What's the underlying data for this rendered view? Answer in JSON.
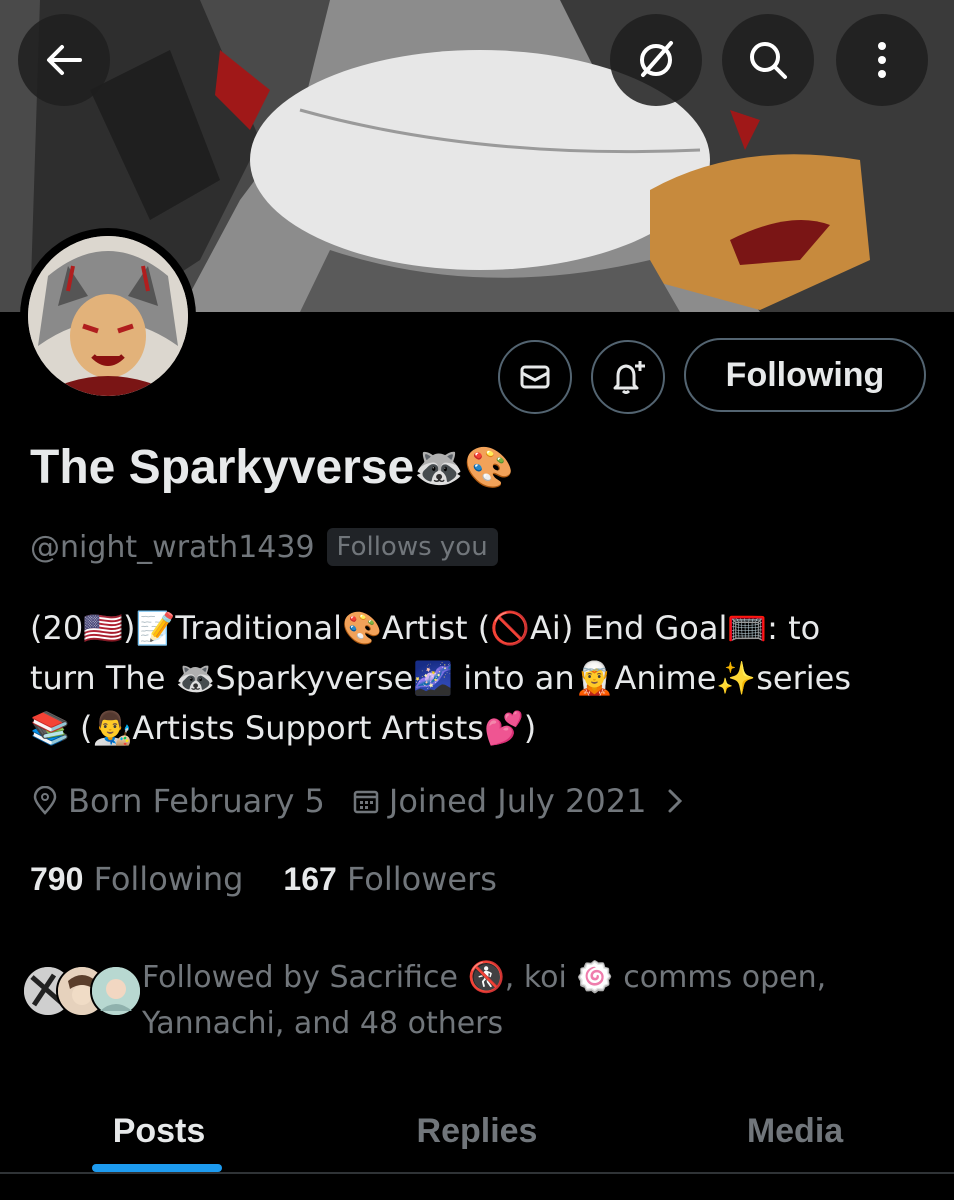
{
  "profile": {
    "display_name": "The Sparkyverse",
    "name_emojis": "🦝🎨",
    "handle": "@night_wrath1439",
    "follows_you_badge": "Follows you",
    "bio_lines": [
      "(20🇺🇸)📝Traditional🎨Artist (🚫Ai) End Goal🥅: to",
      "turn The 🦝Sparkyverse🌌 into an🧝Anime✨series",
      "📚 (👨‍🎨Artists Support Artists💕)"
    ],
    "born": "Born February 5",
    "joined": "Joined July 2021",
    "following_count": "790",
    "following_label": "Following",
    "followers_count": "167",
    "followers_label": "Followers",
    "followed_by_line1": "Followed by Sacrifice 🚷, koi 🍥 comms open,",
    "followed_by_line2": "Yannachi, and 48 others"
  },
  "actions": {
    "following_button": "Following"
  },
  "tabs": [
    {
      "label": "Posts",
      "active": true
    },
    {
      "label": "Replies",
      "active": false
    },
    {
      "label": "Media",
      "active": false
    }
  ],
  "icons": {
    "back": "arrow-left-icon",
    "grok": "slash-circle-icon",
    "search": "search-icon",
    "more": "more-vertical-icon",
    "message": "envelope-icon",
    "notify": "bell-plus-icon",
    "location": "location-pin-icon",
    "calendar": "calendar-icon",
    "chevron": "chevron-right-icon"
  },
  "colors": {
    "background": "#000000",
    "text_primary": "#e7e9ea",
    "text_secondary": "#71767b",
    "accent": "#1d9bf0",
    "border": "#536471"
  }
}
